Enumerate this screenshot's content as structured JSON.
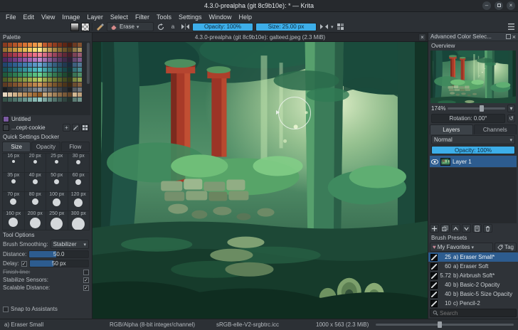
{
  "window": {
    "title": "4.3.0-prealpha (git 8c9b10e): * — Krita"
  },
  "menu": {
    "items": [
      "File",
      "Edit",
      "View",
      "Image",
      "Layer",
      "Select",
      "Filter",
      "Tools",
      "Settings",
      "Window",
      "Help"
    ]
  },
  "toolbar": {
    "erase": "Erase",
    "opacity": "Opacity: 100%",
    "size": "Size: 25.00 px"
  },
  "palette": {
    "title": "Palette",
    "untitled": "Untitled",
    "item": "...cept-cookie",
    "rows": [
      [
        "#8a3b20",
        "#a14824",
        "#b55629",
        "#c8642e",
        "#d97434",
        "#e6853c",
        "#f09747",
        "#f6a955",
        "#c05a2e",
        "#a84a26",
        "#8f3c1f",
        "#763019",
        "#5e2614",
        "#481d10",
        "#6b3a22",
        "#84512f"
      ],
      [
        "#9a7030",
        "#b08338",
        "#c59640",
        "#d6a849",
        "#e4ba54",
        "#efcb62",
        "#f7db74",
        "#fae98c",
        "#d9bb6b",
        "#bf9f55",
        "#a48443",
        "#886b34",
        "#6d5428",
        "#543f1e",
        "#8f7a48",
        "#ab9560"
      ],
      [
        "#7e2939",
        "#963245",
        "#ac3c52",
        "#c04760",
        "#d1536d",
        "#e0617b",
        "#ec7189",
        "#f58298",
        "#d66a85",
        "#b85670",
        "#99445c",
        "#7b3449",
        "#602737",
        "#491d2a",
        "#7c4257",
        "#985a70"
      ],
      [
        "#50285e",
        "#613271",
        "#723d83",
        "#834994",
        "#9356a4",
        "#a365b2",
        "#b275bf",
        "#c086ca",
        "#a26eae",
        "#875a93",
        "#6d4878",
        "#563861",
        "#402a4b",
        "#2f1f38",
        "#644771",
        "#7f5c8c"
      ],
      [
        "#21456e",
        "#285280",
        "#306090",
        "#396da0",
        "#437bae",
        "#4e89bb",
        "#5b97c7",
        "#69a5d2",
        "#5289b4",
        "#437398",
        "#355e7e",
        "#2a4b66",
        "#203950",
        "#18293c",
        "#3d5f7e",
        "#527694"
      ],
      [
        "#175058",
        "#1d6169",
        "#24727a",
        "#2c838b",
        "#35949b",
        "#3fa5ab",
        "#4ab5ba",
        "#56c5c9",
        "#44a4a9",
        "#368b90",
        "#2a7377",
        "#205c60",
        "#17474a",
        "#103436",
        "#327076",
        "#478a8f"
      ],
      [
        "#1f5a3b",
        "#266b46",
        "#2e7c51",
        "#378d5c",
        "#419e68",
        "#4caf74",
        "#58bf80",
        "#66cf8d",
        "#52ad76",
        "#429161",
        "#34774f",
        "#285f3f",
        "#1e4930",
        "#153523",
        "#3a7354",
        "#4f8e69"
      ],
      [
        "#4c5a24",
        "#5b6b2b",
        "#6a7c32",
        "#7a8d3a",
        "#8a9e43",
        "#9aae4d",
        "#aabf58",
        "#bace64",
        "#9cab4f",
        "#849140",
        "#6d7833",
        "#586128",
        "#444c1f",
        "#333916",
        "#79863e",
        "#93a150"
      ],
      [
        "#5e3a22",
        "#6f4628",
        "#80522e",
        "#905e35",
        "#a06b3c",
        "#b07844",
        "#bf864d",
        "#cd9457",
        "#ab7a45",
        "#916637",
        "#78542c",
        "#614322",
        "#4c341a",
        "#392713",
        "#6b4c30",
        "#835f3f"
      ],
      [
        "#1b1d1f",
        "#2a2d30",
        "#393d41",
        "#484d52",
        "#585e63",
        "#686f75",
        "#798087",
        "#8a9299",
        "#767d84",
        "#62686e",
        "#4f545a",
        "#3d4247",
        "#2c3034",
        "#1d2023",
        "#555b61",
        "#6e757c"
      ],
      [
        "#e8d8c0",
        "#ddc5a4",
        "#d1b28a",
        "#c5a072",
        "#b98e5c",
        "#ac7c48",
        "#9f6b36",
        "#925b26",
        "#c9a87c",
        "#b5946a",
        "#a18058",
        "#8d6c47",
        "#795938",
        "#65472a",
        "#d3b791",
        "#c0a37e"
      ],
      [
        "#355248",
        "#41635a",
        "#4e746b",
        "#5b857c",
        "#69968e",
        "#77a79f",
        "#86b8b1",
        "#95c9c2",
        "#7da79f",
        "#668d85",
        "#52746c",
        "#405c55",
        "#30453f",
        "#22322d",
        "#5c7d74",
        "#71938a"
      ]
    ]
  },
  "quick": {
    "title": "Quick Settings Docker",
    "tabs": [
      "Size",
      "Opacity",
      "Flow"
    ],
    "sizes": [
      {
        "label": "16 px",
        "value": 16
      },
      {
        "label": "20 px",
        "value": 20
      },
      {
        "label": "25 px",
        "value": 25
      },
      {
        "label": "30 px",
        "value": 30
      },
      {
        "label": "35 px",
        "value": 35
      },
      {
        "label": "40 px",
        "value": 40
      },
      {
        "label": "50 px",
        "value": 50
      },
      {
        "label": "60 px",
        "value": 60
      },
      {
        "label": "70 px",
        "value": 70
      },
      {
        "label": "80 px",
        "value": 80
      },
      {
        "label": "100 px",
        "value": 100
      },
      {
        "label": "120 px",
        "value": 120
      },
      {
        "label": "160 px",
        "value": 160
      },
      {
        "label": "200 px",
        "value": 200
      },
      {
        "label": "250 px",
        "value": 250
      },
      {
        "label": "300 px",
        "value": 300
      }
    ]
  },
  "tool_options": {
    "title": "Tool Options",
    "smoothing_label": "Brush Smoothing:",
    "smoothing_value": "Stabilizer",
    "distance_label": "Distance:",
    "distance_value": "50.0",
    "delay_label": "Delay:",
    "delay_value": "50 px",
    "finish_label": "Finish line:",
    "stabilize_label": "Stabilize Sensors:",
    "scalable_label": "Scalable Distance:",
    "snap_label": "Snap to Assistants"
  },
  "canvas": {
    "title": "4.3.0-prealpha (git 8c9b10e): galteed.jpeg (2.3 MiB)"
  },
  "right": {
    "advanced_title": "Advanced Color Selec...",
    "overview": {
      "title": "Overview",
      "zoom": "174%",
      "rotation": "Rotation: 0.00°"
    },
    "layers": {
      "tabs": [
        "Layers",
        "Channels"
      ],
      "blend": "Normal",
      "opacity": "Opacity: 100%",
      "layer": "Layer 1"
    },
    "presets": {
      "title": "Brush Presets",
      "favorites": "My Favorites",
      "tag": "Tag",
      "search": "Search",
      "items": [
        {
          "size": "25",
          "name": "a) Eraser Small*",
          "selected": true
        },
        {
          "size": "60",
          "name": "a) Eraser Soft",
          "selected": false
        },
        {
          "size": "5.72",
          "name": "b) Airbrush Soft*",
          "selected": false
        },
        {
          "size": "40",
          "name": "b) Basic-2 Opacity",
          "selected": false
        },
        {
          "size": "40",
          "name": "b) Basic-5 Size Opacity",
          "selected": false
        },
        {
          "size": "10",
          "name": "c) Pencil-2",
          "selected": false
        }
      ]
    }
  },
  "statusbar": {
    "brush": "a) Eraser Small",
    "mode": "RGB/Alpha (8-bit integer/channel)",
    "profile": "sRGB-elle-V2-srgbtrc.icc",
    "dims": "1000 x 563 (2.3 MiB)"
  },
  "colors": {
    "accent": "#3daee9",
    "selection": "#2d5c8f",
    "panel": "#2f3338"
  }
}
